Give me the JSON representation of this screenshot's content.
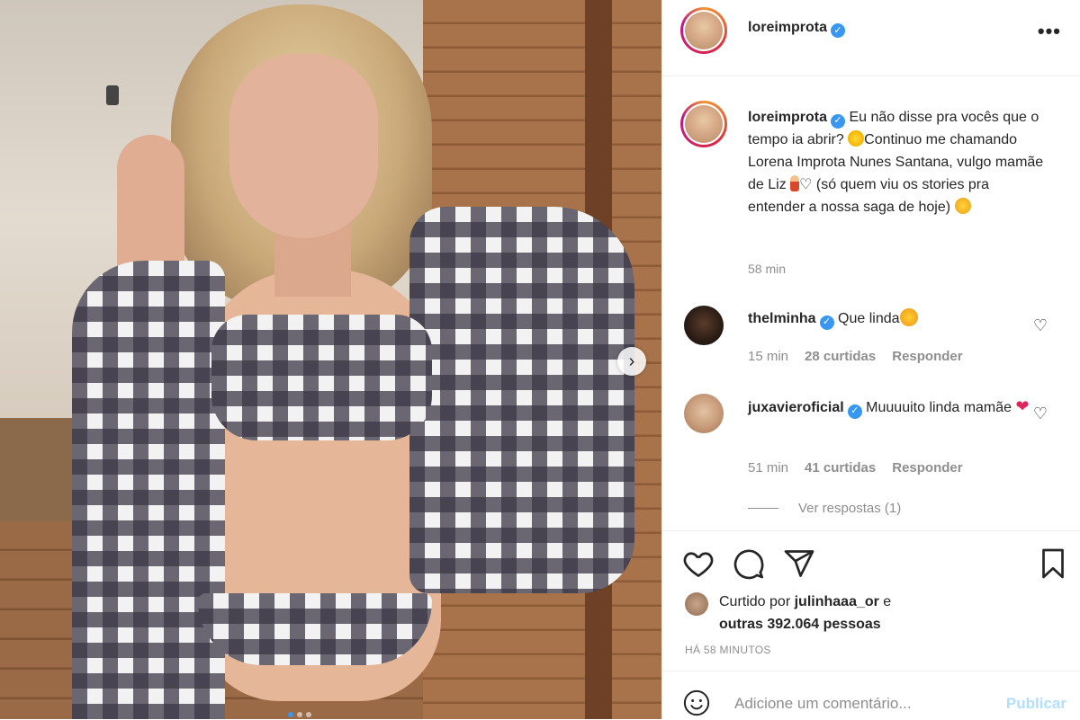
{
  "post": {
    "author": "loreimprota",
    "next_icon": "chevron-right-icon",
    "more_icon": "ellipsis-icon"
  },
  "caption": {
    "username": "loreimprota",
    "text_1": "Eu não disse pra vocês que o tempo ia abrir? ",
    "text_2": "Continuo me chamando Lorena Improta Nunes Santana, vulgo mamãe de Liz ",
    "text_3": " (só quem viu os stories pra entender a nossa saga de hoje) ",
    "time": "58 min"
  },
  "comments": [
    {
      "username": "thelminha",
      "text": "Que linda",
      "time": "15 min",
      "likes": "28 curtidas",
      "reply": "Responder"
    },
    {
      "username": "juxavieroficial",
      "text": "Muuuuito linda mamãe",
      "time": "51 min",
      "likes": "41 curtidas",
      "reply": "Responder"
    }
  ],
  "replies_label": "Ver respostas (1)",
  "likes": {
    "prefix": "Curtido por",
    "user": "julinhaaa_or",
    "joiner": " e",
    "others": "outras 392.064 pessoas"
  },
  "posted_ago": "HÁ 58 MINUTOS",
  "comment_box": {
    "placeholder": "Adicione um comentário...",
    "publish": "Publicar"
  },
  "colors": {
    "verified": "#3897f0",
    "publish_disabled": "#b2dffc",
    "muted_text": "#8e8e8e"
  }
}
